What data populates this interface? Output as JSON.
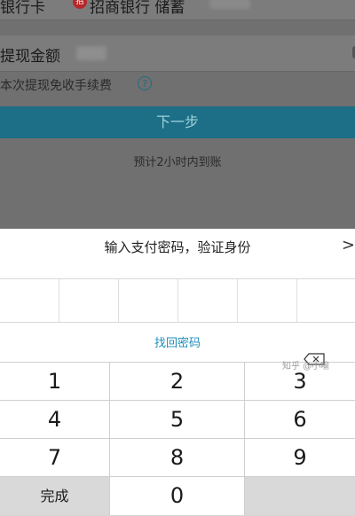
{
  "background": {
    "bank_row": {
      "label": "银行卡",
      "bank_name": "招商银行 储蓄"
    },
    "amount_row": {
      "label": "提现金额"
    },
    "fee_note": "本次提现免收手续费",
    "next_button": "下一步",
    "eta": "预计2小时内到账"
  },
  "sheet": {
    "title": "输入支付密码，验证身份",
    "close_glyph": ">",
    "forgot_link": "找回密码"
  },
  "keypad": {
    "keys": [
      "1",
      "2",
      "3",
      "4",
      "5",
      "6",
      "7",
      "8",
      "9",
      "完成",
      "0"
    ],
    "delete_icon": "backspace-icon"
  },
  "watermark": "知乎 @小喻"
}
